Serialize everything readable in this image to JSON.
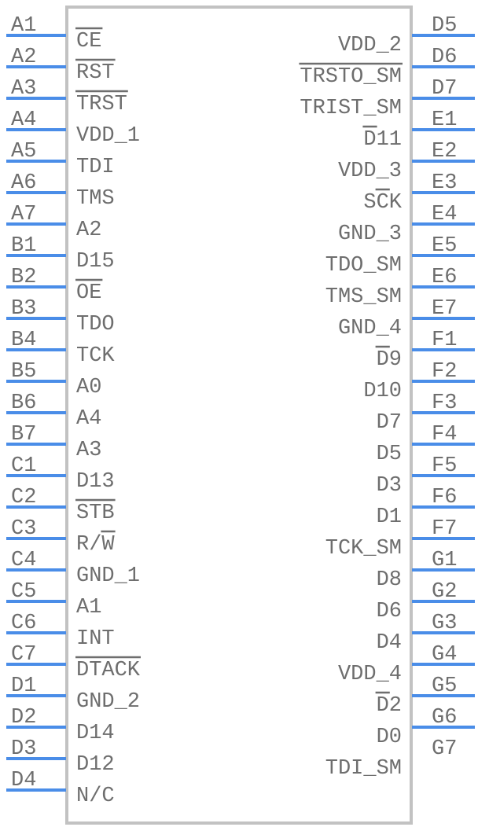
{
  "colors": {
    "pin": "#4a8de8",
    "body_border": "#c2c2c2",
    "text": "#6e6e6e"
  },
  "component": {
    "left_pins": [
      {
        "number": "A1",
        "label": "CE",
        "overline": "all"
      },
      {
        "number": "A2",
        "label": "RST",
        "overline": "all"
      },
      {
        "number": "A3",
        "label": "TRST",
        "overline": "all"
      },
      {
        "number": "A4",
        "label": "VDD_1"
      },
      {
        "number": "A5",
        "label": "TDI"
      },
      {
        "number": "A6",
        "label": "TMS"
      },
      {
        "number": "A7",
        "label": "A2"
      },
      {
        "number": "B1",
        "label": "D15"
      },
      {
        "number": "B2",
        "label": "OE",
        "overline": "all"
      },
      {
        "number": "B3",
        "label": "TDO"
      },
      {
        "number": "B4",
        "label": "TCK"
      },
      {
        "number": "B5",
        "label": "A0"
      },
      {
        "number": "B6",
        "label": "A4"
      },
      {
        "number": "B7",
        "label": "A3"
      },
      {
        "number": "C1",
        "label": "D13"
      },
      {
        "number": "C2",
        "label": "STB",
        "overline": "all"
      },
      {
        "number": "C3",
        "label": "R/W",
        "overline": "last"
      },
      {
        "number": "C4",
        "label": "GND_1"
      },
      {
        "number": "C5",
        "label": "A1"
      },
      {
        "number": "C6",
        "label": "INT"
      },
      {
        "number": "C7",
        "label": "DTACK",
        "overline": "all"
      },
      {
        "number": "D1",
        "label": "GND_2"
      },
      {
        "number": "D2",
        "label": "D14"
      },
      {
        "number": "D3",
        "label": "D12"
      },
      {
        "number": "D4",
        "label": "N/C"
      }
    ],
    "right_pins": [
      {
        "number": "D5",
        "label": "VDD_2"
      },
      {
        "number": "D6",
        "label": "TRSTO_SM",
        "overline": "all"
      },
      {
        "number": "D7",
        "label": "TRIST_SM"
      },
      {
        "number": "E1",
        "label": "D11",
        "overline": "first"
      },
      {
        "number": "E2",
        "label": "VDD_3"
      },
      {
        "number": "E3",
        "label": "SCK",
        "overline": "second"
      },
      {
        "number": "E4",
        "label": "GND_3"
      },
      {
        "number": "E5",
        "label": "TDO_SM"
      },
      {
        "number": "E6",
        "label": "TMS_SM"
      },
      {
        "number": "E7",
        "label": "GND_4"
      },
      {
        "number": "F1",
        "label": "D9",
        "overline": "first"
      },
      {
        "number": "F2",
        "label": "D10"
      },
      {
        "number": "F3",
        "label": "D7"
      },
      {
        "number": "F4",
        "label": "D5"
      },
      {
        "number": "F5",
        "label": "D3"
      },
      {
        "number": "F6",
        "label": "D1"
      },
      {
        "number": "F7",
        "label": "TCK_SM"
      },
      {
        "number": "G1",
        "label": "D8"
      },
      {
        "number": "G2",
        "label": "D6"
      },
      {
        "number": "G3",
        "label": "D4"
      },
      {
        "number": "G4",
        "label": "VDD_4"
      },
      {
        "number": "G5",
        "label": "D2",
        "overline": "first"
      },
      {
        "number": "G6",
        "label": "D0"
      },
      {
        "number": "G7",
        "label": "TDI_SM"
      }
    ]
  }
}
